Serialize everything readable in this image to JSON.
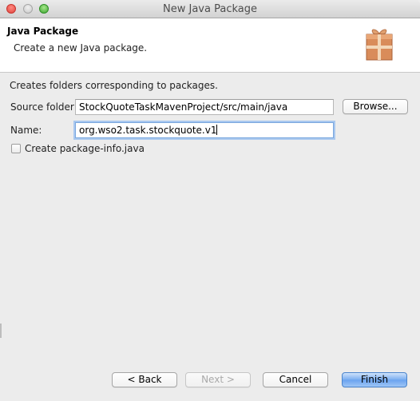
{
  "window": {
    "title": "New Java Package"
  },
  "banner": {
    "title": "Java Package",
    "description": "Create a new Java package.",
    "icon": "package-icon"
  },
  "form": {
    "info": "Creates folders corresponding to packages.",
    "source_folder_label": "Source folder:",
    "source_folder_value": "StockQuoteTaskMavenProject/src/main/java",
    "browse_label": "Browse...",
    "name_label": "Name:",
    "name_value": "org.wso2.task.stockquote.v1",
    "create_package_info_label": "Create package-info.java",
    "create_package_info_checked": false
  },
  "buttons": {
    "back": "< Back",
    "next": "Next >",
    "cancel": "Cancel",
    "finish": "Finish"
  },
  "colors": {
    "accent": "#6aa3ef",
    "focus_ring": "#a9c8ef",
    "window_bg": "#ececec"
  }
}
